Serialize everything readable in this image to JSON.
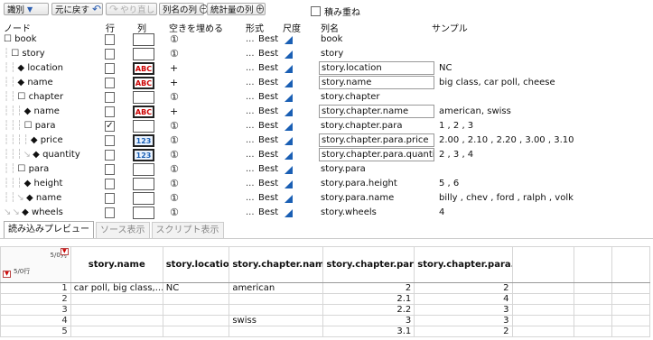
{
  "toolbar": {
    "identify_label": "識別",
    "undo_label": "元に戻す",
    "redo_label": "やり直し",
    "names_col_label": "列名の列",
    "stats_col_label": "統計量の列",
    "stack_label": "積み重ね"
  },
  "tree_headers": {
    "node": "ノード",
    "row": "行",
    "column": "列",
    "fill": "空きを埋める",
    "format": "形式",
    "measure": "尺度",
    "colname": "列名",
    "sample": "サンプル"
  },
  "tree_rows": [
    {
      "guide": "",
      "marker": "☐",
      "label": "book",
      "row_checked": false,
      "icon": "std",
      "icon_text": "",
      "fill": "①",
      "format": "...",
      "best": "Best",
      "colname": "book",
      "boxed": false,
      "sample": ""
    },
    {
      "guide": "┆",
      "marker": "☐",
      "label": "story",
      "row_checked": false,
      "icon": "std",
      "icon_text": "",
      "fill": "①",
      "format": "...",
      "best": "Best",
      "colname": "story",
      "boxed": false,
      "sample": ""
    },
    {
      "guide": "┆ ┆",
      "marker": "◆",
      "label": "location",
      "row_checked": false,
      "icon": "abc",
      "icon_text": "ABC",
      "fill": "+",
      "format": "...",
      "best": "Best",
      "colname": "story.location",
      "boxed": true,
      "sample": "NC"
    },
    {
      "guide": "┆ ┆",
      "marker": "◆",
      "label": "name",
      "row_checked": false,
      "icon": "abc",
      "icon_text": "ABC",
      "fill": "+",
      "format": "...",
      "best": "Best",
      "colname": "story.name",
      "boxed": true,
      "sample": "big class, car poll, cheese"
    },
    {
      "guide": "┆ ┆",
      "marker": "☐",
      "label": "chapter",
      "row_checked": false,
      "icon": "std",
      "icon_text": "",
      "fill": "①",
      "format": "...",
      "best": "Best",
      "colname": "story.chapter",
      "boxed": false,
      "sample": ""
    },
    {
      "guide": "┆ ┆ ┆",
      "marker": "◆",
      "label": "name",
      "row_checked": false,
      "icon": "abc",
      "icon_text": "ABC",
      "fill": "+",
      "format": "...",
      "best": "Best",
      "colname": "story.chapter.name",
      "boxed": true,
      "sample": "american, swiss"
    },
    {
      "guide": "┆ ┆ ┆",
      "marker": "☐",
      "label": "para",
      "row_checked": true,
      "icon": "std",
      "icon_text": "",
      "fill": "①",
      "format": "...",
      "best": "Best",
      "colname": "story.chapter.para",
      "boxed": false,
      "sample": "1 , 2 , 3"
    },
    {
      "guide": "┆ ┆ ┆ ┆",
      "marker": "◆",
      "label": "price",
      "row_checked": false,
      "icon": "num",
      "icon_text": "123",
      "fill": "①",
      "format": "...",
      "best": "Best",
      "colname": "story.chapter.para.price",
      "boxed": true,
      "sample": "2.00 , 2.10 , 2.20 , 3.00 , 3.10"
    },
    {
      "guide": "┆ ┆ ┆ ↘",
      "marker": "◆",
      "label": "quantity",
      "row_checked": false,
      "icon": "num",
      "icon_text": "123",
      "fill": "①",
      "format": "...",
      "best": "Best",
      "colname": "story.chapter.para.quantity",
      "boxed": true,
      "sample": "2 , 3 , 4"
    },
    {
      "guide": "┆ ┆",
      "marker": "☐",
      "label": "para",
      "row_checked": false,
      "icon": "std",
      "icon_text": "",
      "fill": "①",
      "format": "...",
      "best": "Best",
      "colname": "story.para",
      "boxed": false,
      "sample": ""
    },
    {
      "guide": "┆ ┆ ┆",
      "marker": "◆",
      "label": "height",
      "row_checked": false,
      "icon": "std",
      "icon_text": "",
      "fill": "①",
      "format": "...",
      "best": "Best",
      "colname": "story.para.height",
      "boxed": false,
      "sample": "5 , 6"
    },
    {
      "guide": "┆ ┆ ↘",
      "marker": "◆",
      "label": "name",
      "row_checked": false,
      "icon": "std",
      "icon_text": "",
      "fill": "①",
      "format": "...",
      "best": "Best",
      "colname": "story.para.name",
      "boxed": false,
      "sample": "billy , chev , ford , ralph , volk"
    },
    {
      "guide": "↘ ↘",
      "marker": "◆",
      "label": "wheels",
      "row_checked": false,
      "icon": "std",
      "icon_text": "",
      "fill": "①",
      "format": "...",
      "best": "Best",
      "colname": "story.wheels",
      "boxed": false,
      "sample": "4"
    }
  ],
  "tabs": [
    "読み込みプレビュー",
    "ソース表示",
    "スクリプト表示"
  ],
  "grid": {
    "cols_count": "5/0列",
    "rows_count": "5/0行",
    "headers": [
      "story.name",
      "story.location",
      "story.chapter.name",
      "story.chapter.para.price",
      "story.chapter.para.quantity",
      "",
      "",
      ""
    ],
    "rows": [
      {
        "n": "1",
        "cells": [
          "car poll, big class,...",
          "NC",
          "american",
          "2",
          "2",
          "",
          "",
          ""
        ]
      },
      {
        "n": "2",
        "cells": [
          "",
          "",
          "",
          "2.1",
          "4",
          "",
          "",
          ""
        ]
      },
      {
        "n": "3",
        "cells": [
          "",
          "",
          "",
          "2.2",
          "3",
          "",
          "",
          ""
        ]
      },
      {
        "n": "4",
        "cells": [
          "",
          "",
          "swiss",
          "3",
          "3",
          "",
          "",
          ""
        ]
      },
      {
        "n": "5",
        "cells": [
          "",
          "",
          "",
          "3.1",
          "2",
          "",
          "",
          ""
        ]
      }
    ]
  }
}
